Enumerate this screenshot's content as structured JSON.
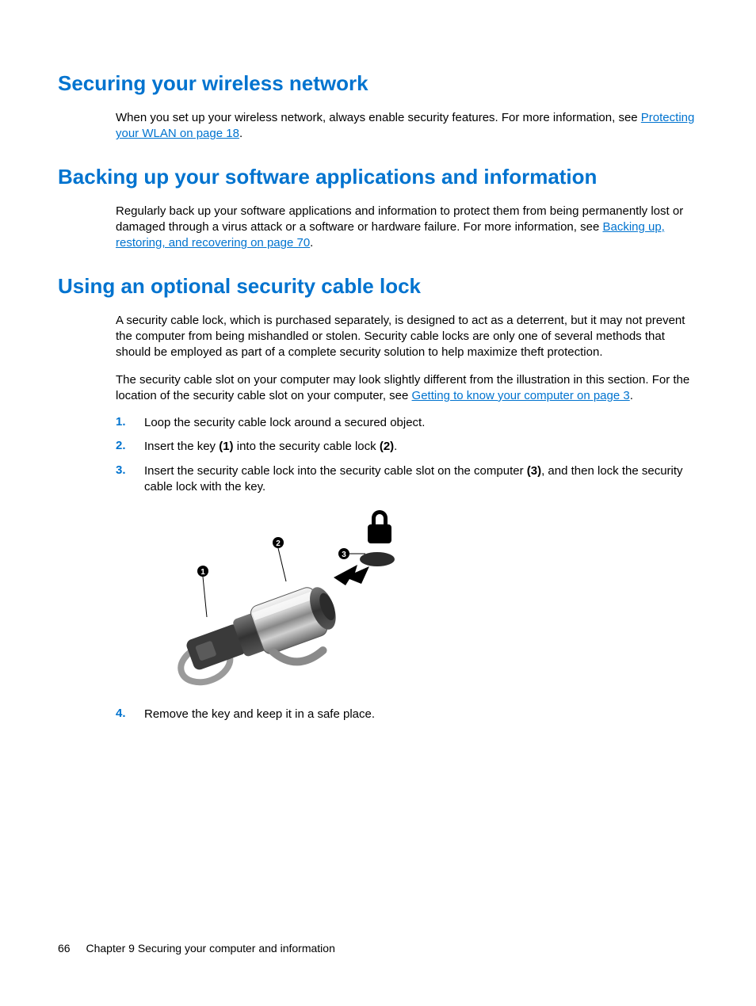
{
  "sections": {
    "s1": {
      "heading": "Securing your wireless network",
      "p1_before": "When you set up your wireless network, always enable security features. For more information, see ",
      "p1_link": "Protecting your WLAN on page 18",
      "p1_after": "."
    },
    "s2": {
      "heading": "Backing up your software applications and information",
      "p1_before": "Regularly back up your software applications and information to protect them from being permanently lost or damaged through a virus attack or a software or hardware failure. For more information, see ",
      "p1_link": "Backing up, restoring, and recovering on page 70",
      "p1_after": "."
    },
    "s3": {
      "heading": "Using an optional security cable lock",
      "p1": "A security cable lock, which is purchased separately, is designed to act as a deterrent, but it may not prevent the computer from being mishandled or stolen. Security cable locks are only one of several methods that should be employed as part of a complete security solution to help maximize theft protection.",
      "p2_before": "The security cable slot on your computer may look slightly different from the illustration in this section. For the location of the security cable slot on your computer, see ",
      "p2_link": "Getting to know your computer on page 3",
      "p2_after": ".",
      "steps": {
        "n1": "1.",
        "t1": "Loop the security cable lock around a secured object.",
        "n2": "2.",
        "t2_a": "Insert the key ",
        "t2_b": "(1)",
        "t2_c": " into the security cable lock ",
        "t2_d": "(2)",
        "t2_e": ".",
        "n3": "3.",
        "t3_a": "Insert the security cable lock into the security cable slot on the computer ",
        "t3_b": "(3)",
        "t3_c": ", and then lock the security cable lock with the key.",
        "n4": "4.",
        "t4": "Remove the key and keep it in a safe place."
      },
      "callouts": {
        "c1": "1",
        "c2": "2",
        "c3": "3"
      }
    }
  },
  "footer": {
    "page_number": "66",
    "chapter": "Chapter 9   Securing your computer and information"
  }
}
